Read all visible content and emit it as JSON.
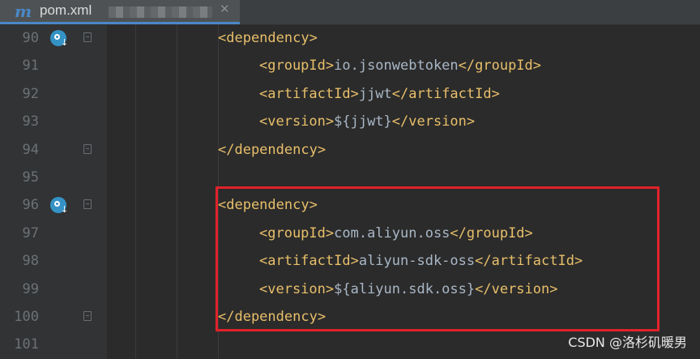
{
  "tab": {
    "icon": "maven-m-icon",
    "icon_glyph": "m",
    "file_name": "pom.xml",
    "close_glyph": "✕"
  },
  "lines": [
    {
      "num": "90",
      "icon": "run-gutter-icon",
      "fold": true,
      "indent": 1,
      "open": "<dependency>",
      "text": "",
      "close": ""
    },
    {
      "num": "91",
      "icon": "",
      "fold": false,
      "indent": 2,
      "open": "<groupId>",
      "text": "io.jsonwebtoken",
      "close": "</groupId>"
    },
    {
      "num": "92",
      "icon": "",
      "fold": false,
      "indent": 2,
      "open": "<artifactId>",
      "text": "jjwt",
      "close": "</artifactId>"
    },
    {
      "num": "93",
      "icon": "",
      "fold": false,
      "indent": 2,
      "open": "<version>",
      "text": "${jjwt}",
      "close": "</version>"
    },
    {
      "num": "94",
      "icon": "",
      "fold": true,
      "indent": 1,
      "open": "</dependency>",
      "text": "",
      "close": ""
    },
    {
      "num": "95",
      "icon": "",
      "fold": false,
      "indent": 0,
      "open": "",
      "text": "",
      "close": ""
    },
    {
      "num": "96",
      "icon": "run-gutter-icon",
      "fold": true,
      "indent": 1,
      "open": "<dependency>",
      "text": "",
      "close": ""
    },
    {
      "num": "97",
      "icon": "",
      "fold": false,
      "indent": 2,
      "open": "<groupId>",
      "text": "com.aliyun.oss",
      "close": "</groupId>"
    },
    {
      "num": "98",
      "icon": "",
      "fold": false,
      "indent": 2,
      "open": "<artifactId>",
      "text": "aliyun-sdk-oss",
      "close": "</artifactId>"
    },
    {
      "num": "99",
      "icon": "",
      "fold": false,
      "indent": 2,
      "open": "<version>",
      "text": "${aliyun.sdk.oss}",
      "close": "</version>"
    },
    {
      "num": "100",
      "icon": "",
      "fold": true,
      "indent": 1,
      "open": "</dependency>",
      "text": "",
      "close": ""
    },
    {
      "num": "101",
      "icon": "",
      "fold": false,
      "indent": 0,
      "open": "",
      "text": "",
      "close": ""
    }
  ],
  "watermark": "CSDN @洛杉矶暖男",
  "colors": {
    "background": "#2b2b2b",
    "tag": "#e8bf6a",
    "text": "#a9b7c6",
    "highlight_box": "#e0222a"
  }
}
